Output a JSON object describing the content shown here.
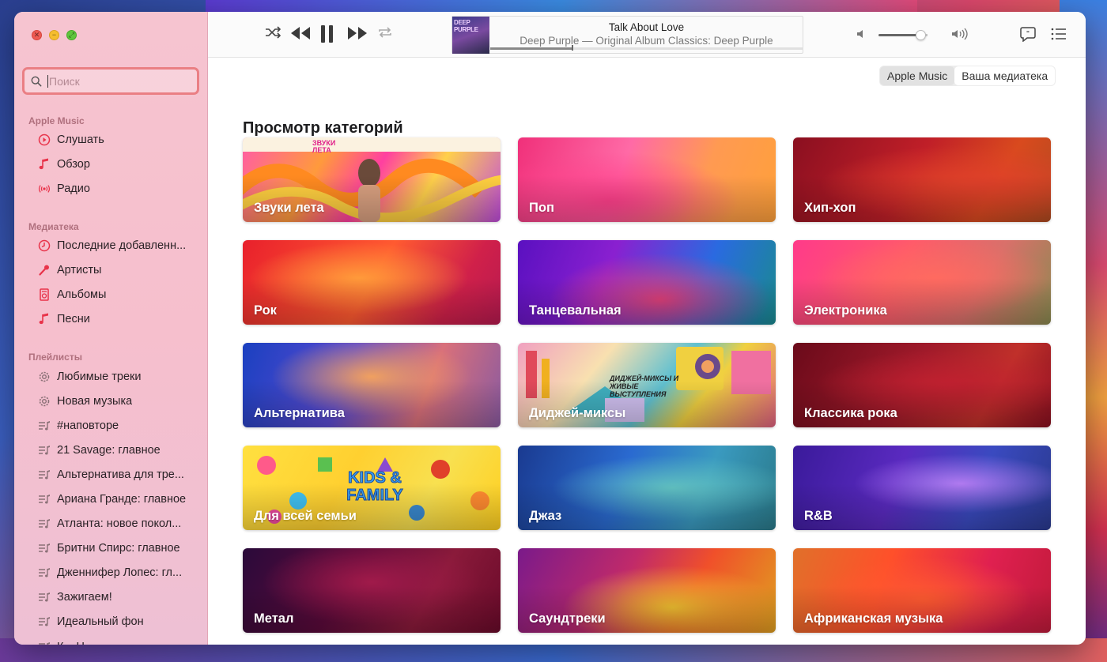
{
  "window": {
    "traffic": [
      "close",
      "minimize",
      "fullscreen"
    ]
  },
  "sidebar": {
    "search": {
      "placeholder": "Поиск",
      "value": ""
    },
    "sections": [
      {
        "title": "Apple Music",
        "items": [
          {
            "label": "Слушать",
            "icon": "play-circle-icon"
          },
          {
            "label": "Обзор",
            "icon": "music-note-icon"
          },
          {
            "label": "Радио",
            "icon": "radio-waves-icon"
          }
        ]
      },
      {
        "title": "Медиатека",
        "items": [
          {
            "label": "Последние добавленн...",
            "icon": "clock-icon"
          },
          {
            "label": "Артисты",
            "icon": "microphone-icon"
          },
          {
            "label": "Альбомы",
            "icon": "album-icon"
          },
          {
            "label": "Песни",
            "icon": "music-note-icon"
          }
        ]
      },
      {
        "title": "Плейлисты",
        "items": [
          {
            "label": "Любимые треки",
            "icon": "gear-icon"
          },
          {
            "label": "Новая музыка",
            "icon": "gear-icon"
          },
          {
            "label": "#наповторе",
            "icon": "playlist-icon"
          },
          {
            "label": "21 Savage: главное",
            "icon": "playlist-icon"
          },
          {
            "label": "Альтернатива для тре...",
            "icon": "playlist-icon"
          },
          {
            "label": "Ариана Гранде: главное",
            "icon": "playlist-icon"
          },
          {
            "label": "Атланта: новое покол...",
            "icon": "playlist-icon"
          },
          {
            "label": "Бритни Спирс: главное",
            "icon": "playlist-icon"
          },
          {
            "label": "Дженнифер Лопес: гл...",
            "icon": "playlist-icon"
          },
          {
            "label": "Зажигаем!",
            "icon": "playlist-icon"
          },
          {
            "label": "Идеальный фон",
            "icon": "playlist-icon"
          },
          {
            "label": "К... Н...",
            "icon": "playlist-icon"
          }
        ]
      }
    ]
  },
  "player": {
    "controls": [
      "shuffle-icon",
      "previous-icon",
      "pause-icon",
      "next-icon",
      "repeat-icon"
    ],
    "now_playing": {
      "title": "Talk About Love",
      "subtitle": "Deep Purple — Original Album Classics: Deep Purple",
      "artwork_text": "DEEP PURPLE",
      "progress": 0.26
    },
    "volume": 0.85,
    "right_icons": [
      "lyrics-icon",
      "queue-list-icon"
    ]
  },
  "main": {
    "segments": [
      {
        "label": "Apple Music",
        "active": true
      },
      {
        "label": "Ваша медиатека",
        "active": false
      }
    ],
    "page_title": "Просмотр категорий",
    "categories": [
      {
        "label": "Звуки лета",
        "badge": "ЗВУКИ ЛЕТА",
        "style": "summer"
      },
      {
        "label": "Поп",
        "style": "pop"
      },
      {
        "label": "Хип-хоп",
        "style": "hiphop"
      },
      {
        "label": "Рок",
        "style": "rock"
      },
      {
        "label": "Танцевальная",
        "style": "dance"
      },
      {
        "label": "Электроника",
        "style": "electronic"
      },
      {
        "label": "Альтернатива",
        "style": "alternative"
      },
      {
        "label": "Диджей-миксы",
        "badge": "ДИДЖЕЙ-МИКСЫ И ЖИВЫЕ ВЫСТУПЛЕНИЯ",
        "style": "dj"
      },
      {
        "label": "Классика рока",
        "style": "classicrock"
      },
      {
        "label": "Для всей семьи",
        "badge": "KIDS & FAMILY",
        "style": "family"
      },
      {
        "label": "Джаз",
        "style": "jazz"
      },
      {
        "label": "R&B",
        "style": "rnb"
      },
      {
        "label": "Метал",
        "style": "metal"
      },
      {
        "label": "Саундтреки",
        "style": "soundtracks"
      },
      {
        "label": "Африканская музыка",
        "style": "african"
      }
    ]
  }
}
